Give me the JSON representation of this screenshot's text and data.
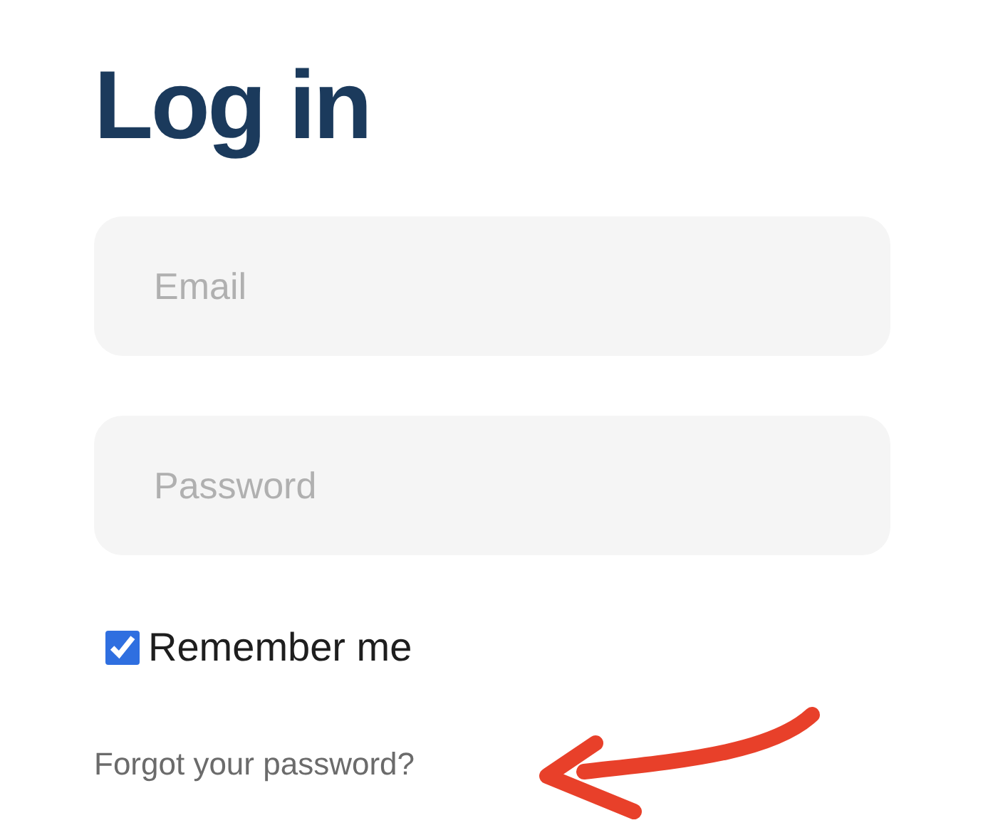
{
  "title": "Log in",
  "fields": [
    {
      "placeholder": "Email"
    },
    {
      "placeholder": "Password"
    }
  ],
  "remember": {
    "label": "Remember me",
    "checked": true
  },
  "forgot_link": "Forgot your password?"
}
